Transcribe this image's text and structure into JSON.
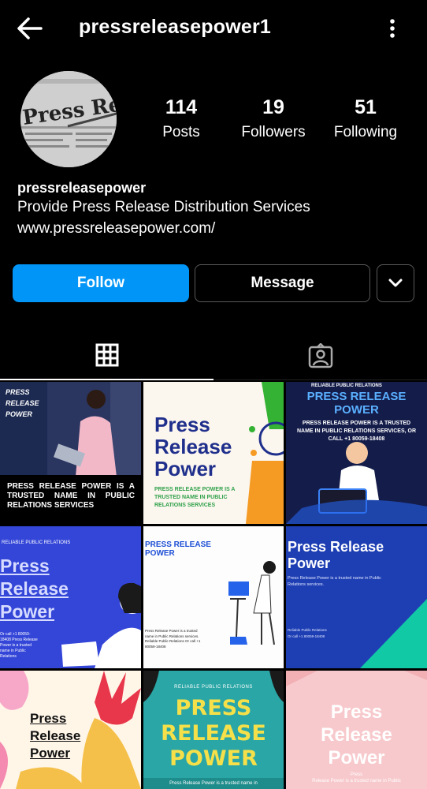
{
  "header": {
    "title": "pressreleasepower1"
  },
  "avatar": {
    "text": "Press Relea"
  },
  "stats": {
    "posts": {
      "value": "114",
      "label": "Posts"
    },
    "followers": {
      "value": "19",
      "label": "Followers"
    },
    "following": {
      "value": "51",
      "label": "Following"
    }
  },
  "bio": {
    "name": "pressreleasepower",
    "description": "Provide Press Release Distribution Services",
    "link": "www.pressreleasepower.com/"
  },
  "actions": {
    "follow": "Follow",
    "message": "Message"
  },
  "posts": {
    "p1": {
      "tag": "PRESS\nRELEASE\nPOWER",
      "caption": "PRESS RELEASE POWER IS A TRUSTED NAME IN PUBLIC RELATIONS SERVICES"
    },
    "p2": {
      "title": "Press\nRelease\nPower",
      "body": "PRESS RELEASE POWER IS A TRUSTED NAME IN PUBLIC RELATIONS SERVICES"
    },
    "p3": {
      "top": "RELIABLE PUBLIC RELATIONS",
      "title": "PRESS RELEASE POWER",
      "body": "PRESS RELEASE POWER IS A TRUSTED NAME IN PUBLIC RELATIONS SERVICES, OR CALL +1 80059-18408"
    },
    "p4": {
      "top": "RELIABLE PUBLIC RELATIONS",
      "title": "Press\nRelease\nPower",
      "body": "Or call +1 80059-18408 Press Release Power is a trusted name in Public Relations"
    },
    "p5": {
      "title": "PRESS RELEASE\nPOWER",
      "body": "Press Release Power is a trusted name in Public Relations services. Reliable Public Relations Or call +1 80059-18408"
    },
    "p6": {
      "title": "Press Release\nPower",
      "body": "Press Release Power is a trusted name in Public Relations services.",
      "footer": "Reliable Public Relations\nOr call +1 80059-18408"
    },
    "p7": {
      "title": "Press\nRelease\nPower"
    },
    "p8": {
      "top": "RELIABLE PUBLIC RELATIONS",
      "title": "PRESS\nRELEASE\nPOWER",
      "body": "Press Release Power is a trusted name in"
    },
    "p9": {
      "title": "Press\nRelease\nPower",
      "body": "Press\nRelease Power is a trusted name in Public"
    }
  }
}
